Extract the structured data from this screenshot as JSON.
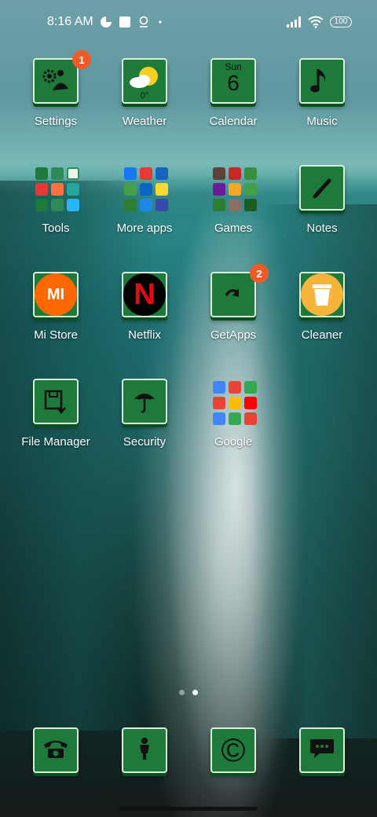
{
  "status_bar": {
    "time": "8:16 AM",
    "battery": "100",
    "icons": [
      "data-saver-icon",
      "square-notification-icon",
      "lens-icon",
      "dot-icon",
      "signal-icon",
      "wifi-icon",
      "battery-icon"
    ]
  },
  "apps": [
    {
      "label": "Settings",
      "icon": "settings-icon",
      "badge": "1"
    },
    {
      "label": "Weather",
      "icon": "weather-icon",
      "temp": "0°"
    },
    {
      "label": "Calendar",
      "icon": "calendar-icon",
      "day": "Sun",
      "date": "6"
    },
    {
      "label": "Music",
      "icon": "music-note-icon"
    },
    {
      "label": "Tools",
      "icon": "tools-folder-icon"
    },
    {
      "label": "More apps",
      "icon": "more-apps-folder-icon"
    },
    {
      "label": "Games",
      "icon": "games-folder-icon"
    },
    {
      "label": "Notes",
      "icon": "pen-icon"
    },
    {
      "label": "Mi Store",
      "icon": "mi-store-icon",
      "logo_text": "MI"
    },
    {
      "label": "Netflix",
      "icon": "netflix-icon",
      "logo_text": "N"
    },
    {
      "label": "GetApps",
      "icon": "getapps-icon",
      "badge": "2"
    },
    {
      "label": "Cleaner",
      "icon": "cleaner-icon"
    },
    {
      "label": "File Manager",
      "icon": "file-manager-icon"
    },
    {
      "label": "Security",
      "icon": "umbrella-icon"
    },
    {
      "label": "Google",
      "icon": "google-folder-icon"
    }
  ],
  "page_indicator": {
    "pages": 2,
    "active": 2
  },
  "dock": [
    {
      "icon": "phone-icon"
    },
    {
      "icon": "contacts-person-icon"
    },
    {
      "icon": "copyright-browser-icon",
      "glyph": "©"
    },
    {
      "icon": "messages-icon"
    }
  ],
  "colors": {
    "icon_green": "#1e7a3a",
    "badge_orange": "#f05a28",
    "mi_orange": "#ff6700",
    "netflix_red": "#e50914"
  }
}
